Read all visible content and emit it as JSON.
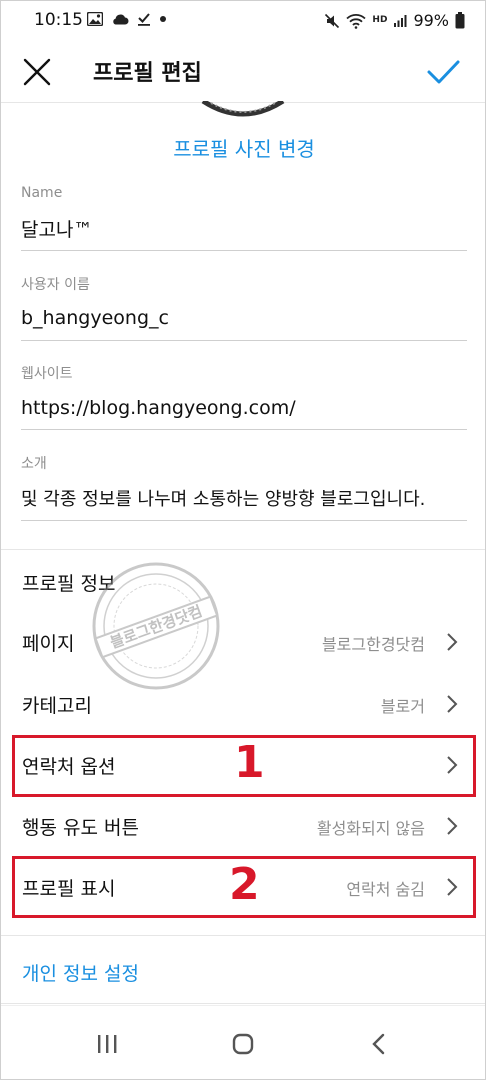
{
  "status_bar": {
    "time": "10:15",
    "battery": "99%",
    "icons_left": [
      "image-icon",
      "cloud-icon",
      "download-done-icon",
      "dot-icon"
    ],
    "icons_right": [
      "mute-icon",
      "wifi-icon",
      "hd-voice-icon",
      "signal-icon",
      "battery-icon"
    ],
    "hd_label": "HD"
  },
  "header": {
    "title": "프로필 편집",
    "close_icon": "close-icon",
    "confirm_icon": "check-icon",
    "accent": "#1a8fe0"
  },
  "profile_photo": {
    "change_label": "프로필 사진 변경"
  },
  "fields": [
    {
      "label": "Name",
      "value": "달고나™"
    },
    {
      "label": "사용자 이름",
      "value": "b_hangyeong_c"
    },
    {
      "label": "웹사이트",
      "value": "https://blog.hangyeong.com/"
    },
    {
      "label": "소개",
      "value": " 및 각종 정보를  나누며 소통하는 양방향  블로그입니다."
    }
  ],
  "rows": [
    {
      "label": "프로필 정보",
      "value": "",
      "chevron": false
    },
    {
      "label": "페이지",
      "value": "블로그한경닷컴",
      "chevron": true
    },
    {
      "label": "카테고리",
      "value": "블로거",
      "chevron": true
    },
    {
      "label": "연락처 옵션",
      "value": "",
      "chevron": true
    },
    {
      "label": "행동 유도 버튼",
      "value": "활성화되지 않음",
      "chevron": true
    },
    {
      "label": "프로필 표시",
      "value": "연락처 숨김",
      "chevron": true
    }
  ],
  "private_settings": "개인 정보 설정",
  "annotations": [
    {
      "number": "1",
      "color": "#d8182a"
    },
    {
      "number": "2",
      "color": "#d8182a"
    }
  ],
  "watermark": {
    "text": "블로그한경닷컴"
  },
  "nav": {
    "recents_icon": "recents-icon",
    "home_icon": "home-icon",
    "back_icon": "back-icon"
  }
}
